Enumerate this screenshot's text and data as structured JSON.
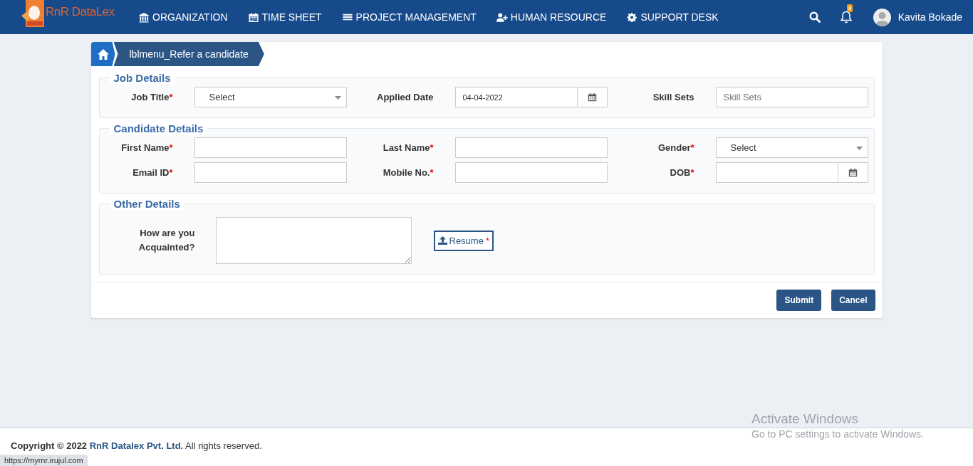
{
  "header": {
    "logo": "RnR DataLex",
    "nav": [
      {
        "label": "ORGANIZATION"
      },
      {
        "label": "TIME SHEET"
      },
      {
        "label": "PROJECT MANAGEMENT"
      },
      {
        "label": "HUMAN RESOURCE"
      },
      {
        "label": "SUPPORT DESK"
      }
    ],
    "notification_count": "3",
    "user": "Kavita Bokade"
  },
  "breadcrumb": {
    "label": "lblmenu_Refer a candidate"
  },
  "sections": [
    {
      "legend": "Job Details",
      "fields": [
        {
          "kind": "select",
          "label": "Job Title",
          "required_mark": "*",
          "value": "Select"
        },
        {
          "kind": "date",
          "label": "Applied Date",
          "value": "04-04-2022"
        },
        {
          "kind": "text",
          "label": "Skill Sets",
          "placeholder": "Skill Sets"
        }
      ]
    },
    {
      "legend": "Candidate Details",
      "fields": [
        {
          "kind": "text",
          "label": "First Name",
          "required_mark": "*"
        },
        {
          "kind": "text",
          "label": "Last Name",
          "required_mark": "*"
        },
        {
          "kind": "select",
          "label": "Gender",
          "required_mark": "*",
          "value": "Select"
        },
        {
          "kind": "text",
          "label": "Email ID",
          "required_mark": "*"
        },
        {
          "kind": "text",
          "label": "Mobile No.",
          "required_mark": "*"
        },
        {
          "kind": "date",
          "label": "DOB",
          "required_mark": "*"
        }
      ]
    },
    {
      "legend": "Other Details",
      "fields": [
        {
          "kind": "textarea",
          "label": "How are you Acquainted?"
        },
        {
          "kind": "upload",
          "label": "Resume",
          "required_mark": "*"
        }
      ]
    }
  ],
  "buttons": [
    "Submit",
    "Cancel"
  ],
  "footer": {
    "copyright": "**Copyright © 2022** **RnR Datalex Pvt. Ltd.** All rights reserved."
  },
  "os_overlay": {
    "title": "Activate Windows",
    "subtitle": "Go to PC settings to activate Windows."
  },
  "status_url": "https://myrnr.irujul.com"
}
